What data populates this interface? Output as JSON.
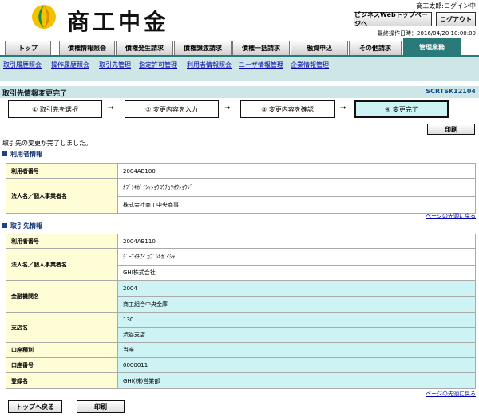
{
  "header": {
    "brand": "商工中金",
    "user_status": "商工太郎:ログイン中",
    "biz_top_button": "ビジネスWebトップページへ",
    "logout_button": "ログアウト",
    "last_operation": "最終操作日時：2016/04/20 10:00:00"
  },
  "tabs": {
    "top": "トップ",
    "items": [
      "債権情報照会",
      "債権発生請求",
      "債権譲渡請求",
      "債権一括請求",
      "融資申込",
      "その他請求",
      "管理業務"
    ]
  },
  "subnav": [
    "取引履歴照会",
    "操作履歴照会",
    "取引先管理",
    "指定許可管理",
    "利用者情報照会",
    "ユーザ情報管理",
    "企業情報管理"
  ],
  "page": {
    "title": "取引先情報変更完了",
    "screen_id": "SCRTSK12104"
  },
  "steps": [
    "① 取引先を選択",
    "② 変更内容を入力",
    "③ 変更内容を確認",
    "④ 変更完了"
  ],
  "print_label": "印刷",
  "message": "取引先の変更が完了しました。",
  "user_info": {
    "section_title": "利用者情報",
    "user_no_label": "利用者番号",
    "user_no": "2004AB100",
    "name_label": "法人名／個人事業者名",
    "name_kana": "ｶﾌﾞｼｷｶﾞｲｼｬｼｮｳｺｳﾁｭｳｵｳｼｮｳｼﾞ",
    "name": "株式会社商工中央商事"
  },
  "back_to_top": "ページの先頭に戻る",
  "partner_info": {
    "section_title": "取引先情報",
    "user_no_label": "利用者番号",
    "user_no": "2004AB110",
    "name_label": "法人名／個人事業者名",
    "name_kana": "ｼﾞｰｴｲﾁｱｲ ｶﾌﾞｼｷｶﾞｲｼｬ",
    "name": "GHI株式会社",
    "bank_label": "金融機関名",
    "bank_code": "2004",
    "bank_name": "商工組合中央金庫",
    "branch_label": "支店名",
    "branch_code": "130",
    "branch_name": "渋谷支店",
    "account_type_label": "口座種別",
    "account_type": "当座",
    "account_no_label": "口座番号",
    "account_no": "0000011",
    "registered_name_label": "登録名",
    "registered_name": "GHI(株)営業部"
  },
  "bottom": {
    "top_button": "トップへ戻る",
    "print_button": "印刷"
  },
  "colors": {
    "accent": "#2a7a7a",
    "subnav_bg": "#cfe6e6",
    "label_bg": "#fffdd6",
    "highlight_bg": "#cdf3f5"
  }
}
